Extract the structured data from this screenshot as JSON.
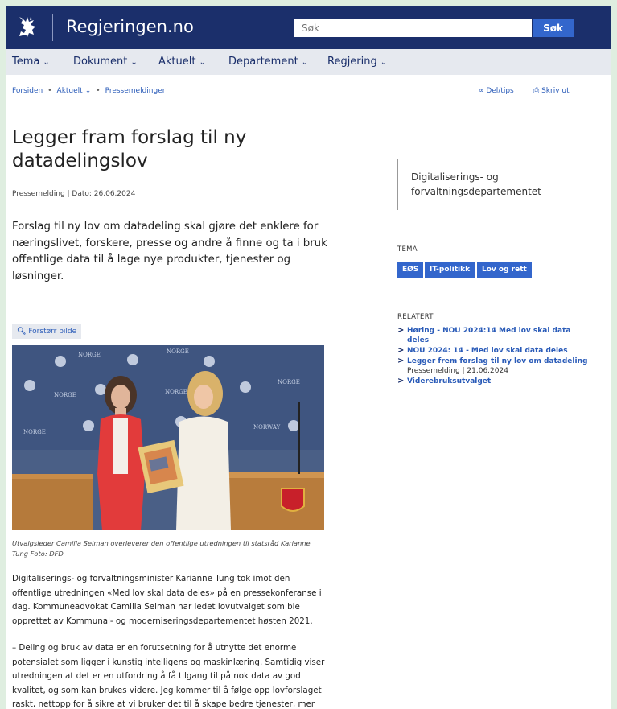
{
  "header": {
    "site_title": "Regjeringen.no",
    "search_placeholder": "Søk",
    "search_button": "Søk"
  },
  "nav": [
    {
      "label": "Tema"
    },
    {
      "label": "Dokument"
    },
    {
      "label": "Aktuelt"
    },
    {
      "label": "Departement"
    },
    {
      "label": "Regjering"
    }
  ],
  "breadcrumb": {
    "items": [
      "Forsiden",
      "Aktuelt",
      "Pressemeldinger"
    ]
  },
  "tools": {
    "share": "Del/tips",
    "print": "Skriv ut"
  },
  "article": {
    "title": "Legger fram forslag til ny datadelingslov",
    "meta": "Pressemelding | Dato: 26.06.2024",
    "lead": "Forslag til ny lov om datadeling skal gjøre det enklere for næringslivet, forskere, presse og andre å finne og ta i bruk offentlige data til å lage nye produkter, tjenester og løsninger.",
    "zoom_label": "Forstørr bilde",
    "photo_backdrop_words": [
      "NORGE",
      "NORGE",
      "NORGE",
      "NORGE",
      "NORGE",
      "NORWAY",
      "NORGE"
    ],
    "caption": "Utvalgsleder Camilla Selman overleverer den offentlige utredningen til statsråd Karianne Tung Foto: DFD",
    "paragraphs": [
      "Digitaliserings- og forvaltningsminister Karianne Tung tok imot den offentlige utredningen «Med lov skal data deles» på en pressekonferanse i dag. Kommuneadvokat Camilla Selman har ledet lovutvalget som ble opprettet av Kommunal- og moderniseringsdepartementet høsten 2021.",
      "– Deling og bruk av data er en forutsetning for å utnytte det enorme potensialet som ligger i kunstig intelligens og maskinlæring. Samtidig viser utredningen at det er en utfordring å få tilgang til på nok data av god kvalitet, og som kan brukes videre. Jeg kommer til å følge opp lovforslaget raskt, nettopp for å sikre at vi bruker det til å skape bedre tjenester, mer"
    ]
  },
  "sidebar": {
    "ministry": "Digitaliserings- og forvaltningsdepartementet",
    "tema_heading": "TEMA",
    "tags": [
      "EØS",
      "IT-politikk",
      "Lov og rett"
    ],
    "related_heading": "RELATERT",
    "related": [
      {
        "title": "Høring - NOU 2024:14 Med lov skal data deles",
        "sub": ""
      },
      {
        "title": "NOU 2024: 14 - Med lov skal data deles",
        "sub": ""
      },
      {
        "title": "Legger frem forslag til ny lov om datadeling",
        "sub": "Pressemelding | 21.06.2024"
      },
      {
        "title": "Viderebruksutvalget",
        "sub": ""
      }
    ]
  },
  "colors": {
    "header_bg": "#1b2f6b",
    "accent": "#3366cc",
    "nav_bg": "#e6e9ef"
  }
}
